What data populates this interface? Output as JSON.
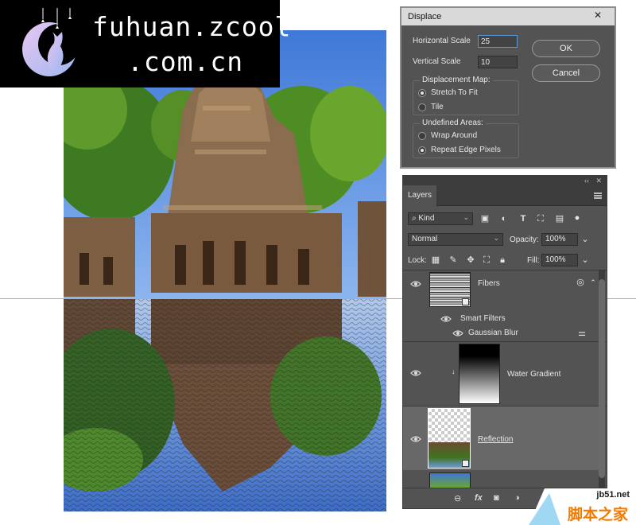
{
  "logo": {
    "line1": "fuhuan.zcool",
    "line2": ".com.cn"
  },
  "displace": {
    "title": "Displace",
    "close_glyph": "✕",
    "horizontal_scale_label": "Horizontal Scale",
    "horizontal_scale_value": "25",
    "vertical_scale_label": "Vertical Scale",
    "vertical_scale_value": "10",
    "ok_label": "OK",
    "cancel_label": "Cancel",
    "displacement_map": {
      "title": "Displacement Map:",
      "options": [
        "Stretch To Fit",
        "Tile"
      ],
      "selected": "Stretch To Fit"
    },
    "undefined_areas": {
      "title": "Undefined Areas:",
      "options": [
        "Wrap Around",
        "Repeat Edge Pixels"
      ],
      "selected": "Repeat Edge Pixels"
    }
  },
  "layers_panel": {
    "collapse_glyph": "‹‹",
    "close_glyph": "✕",
    "tab": "Layers",
    "filter_kind": "Kind",
    "blend_mode": "Normal",
    "opacity_label": "Opacity:",
    "opacity_value": "100%",
    "lock_label": "Lock:",
    "fill_label": "Fill:",
    "fill_value": "100%",
    "layers": [
      {
        "name": "Fibers",
        "type": "smart-object"
      },
      {
        "name": "Smart Filters",
        "type": "smart-filters"
      },
      {
        "name": "Gaussian Blur",
        "type": "filter"
      },
      {
        "name": "Water Gradient",
        "type": "gradient"
      },
      {
        "name": "Reflection",
        "type": "smart-object"
      }
    ],
    "bottom_icons": [
      "link-icon",
      "fx-icon",
      "mask-icon",
      "adjustment-icon"
    ],
    "fx_label": "fx"
  },
  "watermark": {
    "site": "jb51.net",
    "name": "脚本之家"
  },
  "colors": {
    "panel": "#535353",
    "panel_dark": "#3c3c3c",
    "guide": "#6fc3ea",
    "accent": "#5b9bd5"
  }
}
